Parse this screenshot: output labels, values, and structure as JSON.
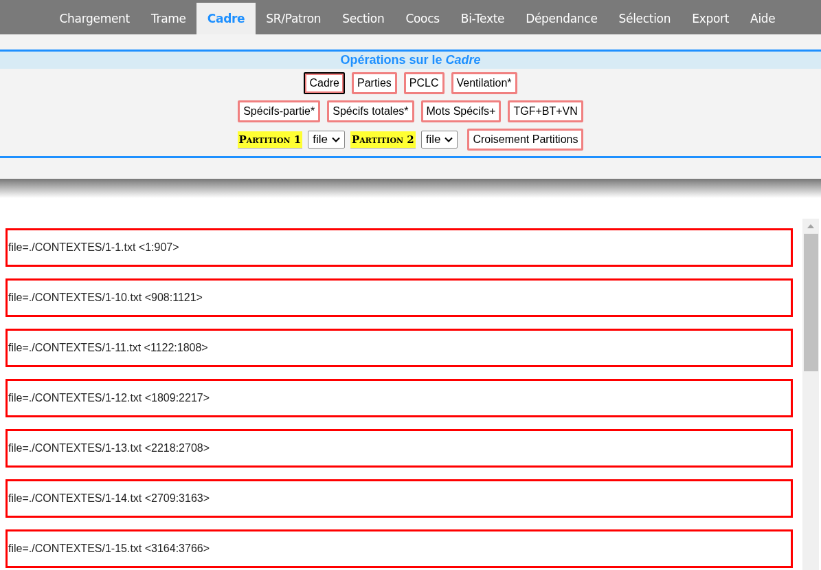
{
  "tabs": [
    {
      "label": "Chargement",
      "selected": false
    },
    {
      "label": "Trame",
      "selected": false
    },
    {
      "label": "Cadre",
      "selected": true
    },
    {
      "label": "SR/Patron",
      "selected": false
    },
    {
      "label": "Section",
      "selected": false
    },
    {
      "label": "Coocs",
      "selected": false
    },
    {
      "label": "Bi-Texte",
      "selected": false
    },
    {
      "label": "Dépendance",
      "selected": false
    },
    {
      "label": "Sélection",
      "selected": false
    },
    {
      "label": "Export",
      "selected": false
    },
    {
      "label": "Aide",
      "selected": false
    }
  ],
  "panel": {
    "title": "Opérations sur le *Cadre*",
    "button_rows": [
      [
        {
          "label": "Cadre",
          "selected": true
        },
        {
          "label": "Parties",
          "selected": false
        },
        {
          "label": "PCLC",
          "selected": false
        },
        {
          "label": "Ventilation*",
          "selected": false
        }
      ],
      [
        {
          "label": "Spécifs-partie*",
          "selected": false
        },
        {
          "label": "Spécifs totales*",
          "selected": false
        },
        {
          "label": "Mots Spécifs+",
          "selected": false
        },
        {
          "label": "TGF+BT+VN",
          "selected": false
        }
      ]
    ],
    "partitions": [
      {
        "label": "Partition 1",
        "value": "file"
      },
      {
        "label": "Partition 2",
        "value": "file"
      }
    ],
    "cross_button": "Croisement Partitions"
  },
  "entries": [
    "file=./CONTEXTES/1-1.txt <1:907>",
    "file=./CONTEXTES/1-10.txt <908:1121>",
    "file=./CONTEXTES/1-11.txt <1122:1808>",
    "file=./CONTEXTES/1-12.txt <1809:2217>",
    "file=./CONTEXTES/1-13.txt <2218:2708>",
    "file=./CONTEXTES/1-14.txt <2709:3163>",
    "file=./CONTEXTES/1-15.txt <3164:3766>"
  ]
}
